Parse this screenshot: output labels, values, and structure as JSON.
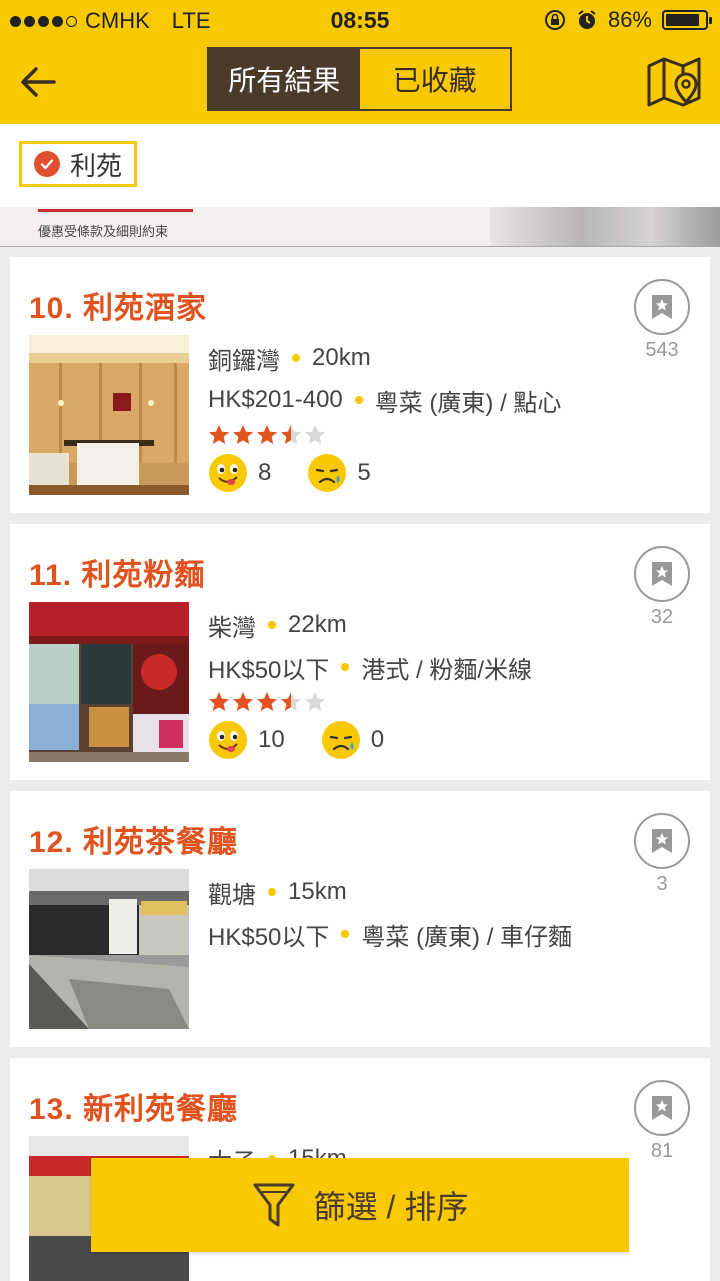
{
  "status": {
    "carrier": "CMHK",
    "network": "LTE",
    "time": "08:55",
    "battery": "86%",
    "battery_level": 0.86
  },
  "nav": {
    "tabs": [
      "所有結果",
      "已收藏"
    ],
    "active_tab": 0
  },
  "filter_chip": {
    "label": "利苑"
  },
  "banner": {
    "text": "優惠受條款及細則約束"
  },
  "restaurants": [
    {
      "title": "10. 利苑酒家",
      "district": "銅鑼灣",
      "distance": "20km",
      "price": "HK$201-400",
      "cuisine": "粵菜 (廣東) / 點心",
      "rating": 3.5,
      "good": "8",
      "bad": "5",
      "bookmarks": "543",
      "show_rating": true
    },
    {
      "title": "11. 利苑粉麵",
      "district": "柴灣",
      "distance": "22km",
      "price": "HK$50以下",
      "cuisine": "港式 / 粉麵/米線",
      "rating": 3.5,
      "good": "10",
      "bad": "0",
      "bookmarks": "32",
      "show_rating": true
    },
    {
      "title": "12. 利苑茶餐廳",
      "district": "觀塘",
      "distance": "15km",
      "price": "HK$50以下",
      "cuisine": "粵菜 (廣東) / 車仔麵",
      "rating": null,
      "good": "",
      "bad": "",
      "bookmarks": "3",
      "show_rating": false
    },
    {
      "title": "13. 新利苑餐廳",
      "district": "太子",
      "distance": "15km",
      "price": "",
      "cuisine": "",
      "rating": null,
      "good": "",
      "bad": "",
      "bookmarks": "81",
      "show_rating": false
    }
  ],
  "bottom_button": {
    "label": "篩選 / 排序"
  },
  "colors": {
    "brand_yellow": "#f8c800",
    "title_orange": "#e0531f",
    "dark_brown": "#4a3a2a"
  }
}
